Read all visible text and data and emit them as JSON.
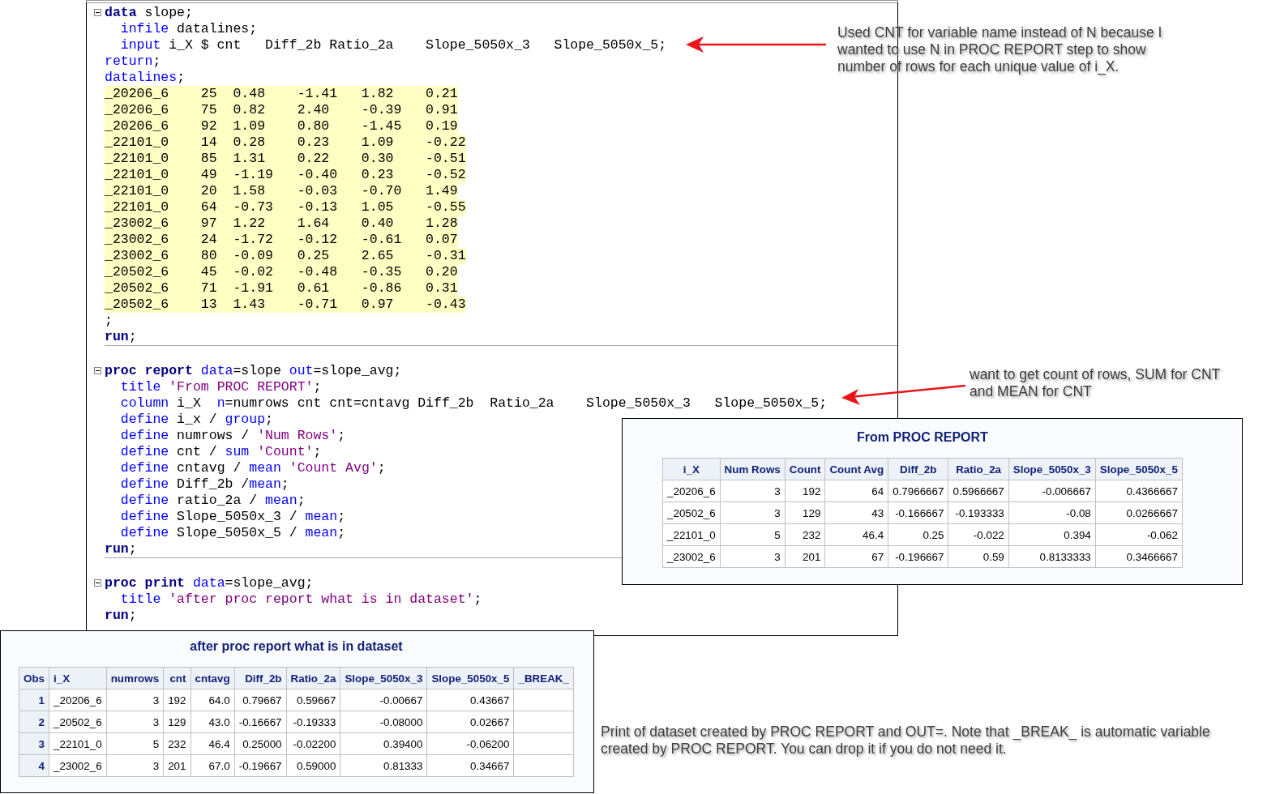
{
  "editor": {
    "sections": [
      {
        "lines": [
          {
            "fold": true,
            "tokens": [
              {
                "kind": "step",
                "text": "data"
              },
              {
                "kind": "plain",
                "text": " slope;"
              }
            ]
          },
          {
            "fold": false,
            "tokens": [
              {
                "kind": "kw",
                "text": "  infile"
              },
              {
                "kind": "plain",
                "text": " datalines;"
              }
            ]
          },
          {
            "fold": false,
            "tokens": [
              {
                "kind": "kw",
                "text": "  input"
              },
              {
                "kind": "plain",
                "text": " i_X $ cnt   Diff_2b Ratio_2a    Slope_5050x_3   Slope_5050x_5;"
              }
            ]
          },
          {
            "fold": false,
            "tokens": [
              {
                "kind": "kw",
                "text": "return"
              },
              {
                "kind": "plain",
                "text": ";"
              }
            ]
          },
          {
            "fold": false,
            "tokens": [
              {
                "kind": "kw",
                "text": "datalines"
              },
              {
                "kind": "plain",
                "text": ";"
              }
            ]
          },
          {
            "fold": false,
            "kind": "data",
            "text": "_20206_6    25  0.48    -1.41   1.82    0.21"
          },
          {
            "fold": false,
            "kind": "data",
            "text": "_20206_6    75  0.82    2.40    -0.39   0.91"
          },
          {
            "fold": false,
            "kind": "data",
            "text": "_20206_6    92  1.09    0.80    -1.45   0.19"
          },
          {
            "fold": false,
            "kind": "data",
            "text": "_22101_0    14  0.28    0.23    1.09    -0.22"
          },
          {
            "fold": false,
            "kind": "data",
            "text": "_22101_0    85  1.31    0.22    0.30    -0.51"
          },
          {
            "fold": false,
            "kind": "data",
            "text": "_22101_0    49  -1.19   -0.40   0.23    -0.52"
          },
          {
            "fold": false,
            "kind": "data",
            "text": "_22101_0    20  1.58    -0.03   -0.70   1.49"
          },
          {
            "fold": false,
            "kind": "data",
            "text": "_22101_0    64  -0.73   -0.13   1.05    -0.55"
          },
          {
            "fold": false,
            "kind": "data",
            "text": "_23002_6    97  1.22    1.64    0.40    1.28"
          },
          {
            "fold": false,
            "kind": "data",
            "text": "_23002_6    24  -1.72   -0.12   -0.61   0.07"
          },
          {
            "fold": false,
            "kind": "data",
            "text": "_23002_6    80  -0.09   0.25    2.65    -0.31"
          },
          {
            "fold": false,
            "kind": "data",
            "text": "_20502_6    45  -0.02   -0.48   -0.35   0.20"
          },
          {
            "fold": false,
            "kind": "data",
            "text": "_20502_6    71  -1.91   0.61    -0.86   0.31"
          },
          {
            "fold": false,
            "kind": "data",
            "text": "_20502_6    13  1.43    -0.71   0.97    -0.43"
          },
          {
            "fold": false,
            "tokens": [
              {
                "kind": "plain",
                "text": ";"
              }
            ]
          },
          {
            "fold": false,
            "tokens": [
              {
                "kind": "step",
                "text": "run"
              },
              {
                "kind": "plain",
                "text": ";"
              }
            ]
          }
        ]
      },
      {
        "lines": [
          {
            "fold": true,
            "tokens": [
              {
                "kind": "step",
                "text": "proc report "
              },
              {
                "kind": "kw",
                "text": "data"
              },
              {
                "kind": "plain",
                "text": "=slope "
              },
              {
                "kind": "kw",
                "text": "out"
              },
              {
                "kind": "plain",
                "text": "=slope_avg;"
              }
            ]
          },
          {
            "fold": false,
            "tokens": [
              {
                "kind": "kw",
                "text": "  title "
              },
              {
                "kind": "str",
                "text": "'From PROC REPORT'"
              },
              {
                "kind": "plain",
                "text": ";"
              }
            ]
          },
          {
            "fold": false,
            "tokens": [
              {
                "kind": "kw",
                "text": "  column"
              },
              {
                "kind": "plain",
                "text": " i_X  "
              },
              {
                "kind": "kw",
                "text": "n"
              },
              {
                "kind": "plain",
                "text": "=numrows cnt cnt=cntavg Diff_2b  Ratio_2a    Slope_5050x_3   Slope_5050x_5;"
              }
            ]
          },
          {
            "fold": false,
            "tokens": [
              {
                "kind": "kw",
                "text": "  define"
              },
              {
                "kind": "plain",
                "text": " i_x / "
              },
              {
                "kind": "kw",
                "text": "group"
              },
              {
                "kind": "plain",
                "text": ";"
              }
            ]
          },
          {
            "fold": false,
            "tokens": [
              {
                "kind": "kw",
                "text": "  define"
              },
              {
                "kind": "plain",
                "text": " numrows / "
              },
              {
                "kind": "str",
                "text": "'Num Rows'"
              },
              {
                "kind": "plain",
                "text": ";"
              }
            ]
          },
          {
            "fold": false,
            "tokens": [
              {
                "kind": "kw",
                "text": "  define"
              },
              {
                "kind": "plain",
                "text": " cnt / "
              },
              {
                "kind": "kw",
                "text": "sum "
              },
              {
                "kind": "str",
                "text": "'Count'"
              },
              {
                "kind": "plain",
                "text": ";"
              }
            ]
          },
          {
            "fold": false,
            "tokens": [
              {
                "kind": "kw",
                "text": "  define"
              },
              {
                "kind": "plain",
                "text": " cntavg / "
              },
              {
                "kind": "kw",
                "text": "mean "
              },
              {
                "kind": "str",
                "text": "'Count Avg'"
              },
              {
                "kind": "plain",
                "text": ";"
              }
            ]
          },
          {
            "fold": false,
            "tokens": [
              {
                "kind": "kw",
                "text": "  define"
              },
              {
                "kind": "plain",
                "text": " Diff_2b /"
              },
              {
                "kind": "kw",
                "text": "mean"
              },
              {
                "kind": "plain",
                "text": ";"
              }
            ]
          },
          {
            "fold": false,
            "tokens": [
              {
                "kind": "kw",
                "text": "  define"
              },
              {
                "kind": "plain",
                "text": " ratio_2a / "
              },
              {
                "kind": "kw",
                "text": "mean"
              },
              {
                "kind": "plain",
                "text": ";"
              }
            ]
          },
          {
            "fold": false,
            "tokens": [
              {
                "kind": "kw",
                "text": "  define"
              },
              {
                "kind": "plain",
                "text": " Slope_5050x_3 / "
              },
              {
                "kind": "kw",
                "text": "mean"
              },
              {
                "kind": "plain",
                "text": ";"
              }
            ]
          },
          {
            "fold": false,
            "tokens": [
              {
                "kind": "kw",
                "text": "  define"
              },
              {
                "kind": "plain",
                "text": " Slope_5050x_5 / "
              },
              {
                "kind": "kw",
                "text": "mean"
              },
              {
                "kind": "plain",
                "text": ";"
              }
            ]
          },
          {
            "fold": false,
            "tokens": [
              {
                "kind": "step",
                "text": "run"
              },
              {
                "kind": "plain",
                "text": ";"
              }
            ]
          }
        ]
      },
      {
        "lines": [
          {
            "fold": true,
            "tokens": [
              {
                "kind": "step",
                "text": "proc print "
              },
              {
                "kind": "kw",
                "text": "data"
              },
              {
                "kind": "plain",
                "text": "=slope_avg;"
              }
            ]
          },
          {
            "fold": false,
            "tokens": [
              {
                "kind": "kw",
                "text": "  title "
              },
              {
                "kind": "str",
                "text": "'after proc report what is in dataset'"
              },
              {
                "kind": "plain",
                "text": ";"
              }
            ]
          },
          {
            "fold": false,
            "tokens": [
              {
                "kind": "step",
                "text": "run"
              },
              {
                "kind": "plain",
                "text": ";"
              }
            ]
          }
        ]
      }
    ]
  },
  "annotations": [
    {
      "text": "Used CNT for variable name instead of N because I wanted to use N in PROC REPORT step to show number of rows for each unique value of i_X."
    },
    {
      "text": "want to get count of rows, SUM for CNT and MEAN for CNT"
    },
    {
      "text": "Print of dataset created by PROC REPORT and OUT=. Note that _BREAK_ is automatic variable created by PROC REPORT. You can drop it if you do not need it."
    }
  ],
  "report": {
    "kind": "report",
    "title": "From PROC REPORT",
    "columns": [
      {
        "label": "i_X",
        "kind": "label"
      },
      {
        "label": "Num Rows",
        "kind": "number"
      },
      {
        "label": "Count",
        "kind": "number"
      },
      {
        "label": "Count Avg",
        "kind": "number"
      },
      {
        "label": "Diff_2b",
        "kind": "number"
      },
      {
        "label": "Ratio_2a",
        "kind": "number"
      },
      {
        "label": "Slope_5050x_3",
        "kind": "number"
      },
      {
        "label": "Slope_5050x_5",
        "kind": "number"
      }
    ],
    "rows": [
      [
        "_20206_6",
        "3",
        "192",
        "64",
        "0.7966667",
        "0.5966667",
        "-0.006667",
        "0.4366667"
      ],
      [
        "_20502_6",
        "3",
        "129",
        "43",
        "-0.166667",
        "-0.193333",
        "-0.08",
        "0.0266667"
      ],
      [
        "_22101_0",
        "5",
        "232",
        "46.4",
        "0.25",
        "-0.022",
        "0.394",
        "-0.062"
      ],
      [
        "_23002_6",
        "3",
        "201",
        "67",
        "-0.196667",
        "0.59",
        "0.8133333",
        "0.3466667"
      ]
    ]
  },
  "print_output": {
    "kind": "print",
    "title": "after proc report what is in dataset",
    "columns": [
      {
        "label": "Obs",
        "kind": "obs"
      },
      {
        "label": "i_X",
        "kind": "label"
      },
      {
        "label": "numrows",
        "kind": "number"
      },
      {
        "label": "cnt",
        "kind": "number"
      },
      {
        "label": "cntavg",
        "kind": "number"
      },
      {
        "label": "Diff_2b",
        "kind": "number"
      },
      {
        "label": "Ratio_2a",
        "kind": "number"
      },
      {
        "label": "Slope_5050x_3",
        "kind": "number"
      },
      {
        "label": "Slope_5050x_5",
        "kind": "number"
      },
      {
        "label": "_BREAK_",
        "kind": "label"
      }
    ],
    "rows": [
      [
        "1",
        "_20206_6",
        "3",
        "192",
        "64.0",
        "0.79667",
        "0.59667",
        "-0.00667",
        "0.43667"
      ],
      [
        "2",
        "_20502_6",
        "3",
        "129",
        "43.0",
        "-0.16667",
        "-0.19333",
        "-0.08000",
        "0.02667"
      ],
      [
        "3",
        "_22101_0",
        "5",
        "232",
        "46.4",
        "0.25000",
        "-0.02200",
        "0.39400",
        "-0.06200"
      ],
      [
        "4",
        "_23002_6",
        "3",
        "201",
        "67.0",
        "-0.19667",
        "0.59000",
        "0.81333",
        "0.34667"
      ]
    ]
  }
}
